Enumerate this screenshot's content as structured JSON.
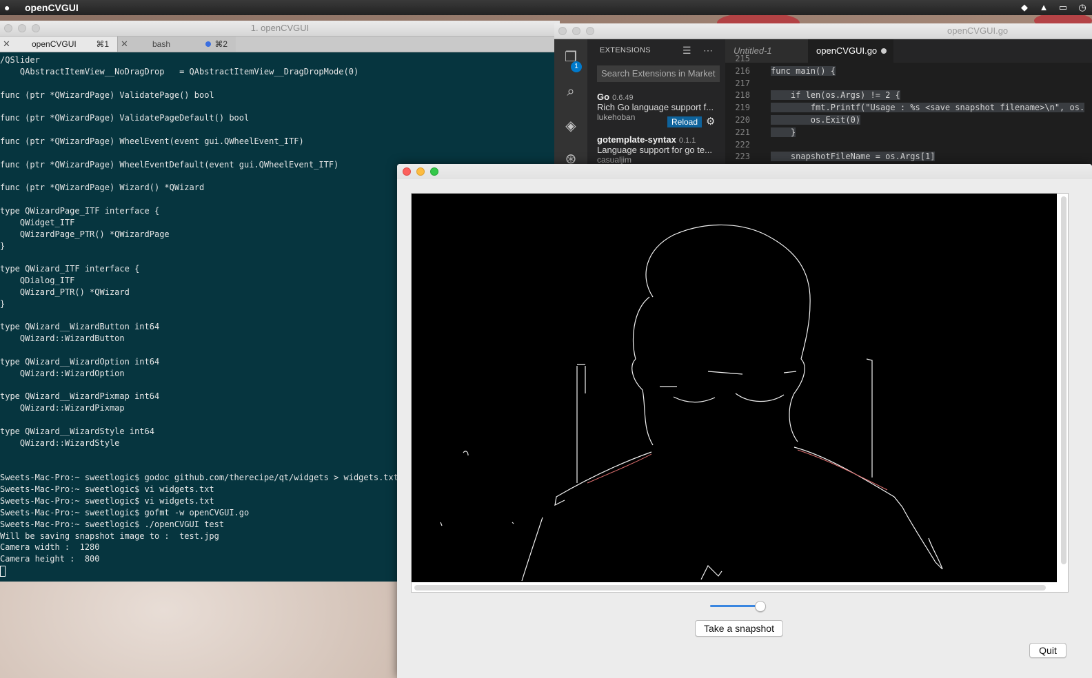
{
  "menubar": {
    "app_name": "openCVGUI"
  },
  "terminal": {
    "title": "1. openCVGUI",
    "tabs": [
      {
        "label": "openCVGUI",
        "shortcut": "⌘1"
      },
      {
        "label": "bash",
        "shortcut": "⌘2"
      }
    ],
    "lines": [
      "/QSlider",
      "    QAbstractItemView__NoDragDrop   = QAbstractItemView__DragDropMode(0)",
      "",
      "func (ptr *QWizardPage) ValidatePage() bool",
      "",
      "func (ptr *QWizardPage) ValidatePageDefault() bool",
      "",
      "func (ptr *QWizardPage) WheelEvent(event gui.QWheelEvent_ITF)",
      "",
      "func (ptr *QWizardPage) WheelEventDefault(event gui.QWheelEvent_ITF)",
      "",
      "func (ptr *QWizardPage) Wizard() *QWizard",
      "",
      "type QWizardPage_ITF interface {",
      "    QWidget_ITF",
      "    QWizardPage_PTR() *QWizardPage",
      "}",
      "",
      "type QWizard_ITF interface {",
      "    QDialog_ITF",
      "    QWizard_PTR() *QWizard",
      "}",
      "",
      "type QWizard__WizardButton int64",
      "    QWizard::WizardButton",
      "",
      "type QWizard__WizardOption int64",
      "    QWizard::WizardOption",
      "",
      "type QWizard__WizardPixmap int64",
      "    QWizard::WizardPixmap",
      "",
      "type QWizard__WizardStyle int64",
      "    QWizard::WizardStyle",
      "",
      "",
      "Sweets-Mac-Pro:~ sweetlogic$ godoc github.com/therecipe/qt/widgets > widgets.txt",
      "Sweets-Mac-Pro:~ sweetlogic$ vi widgets.txt",
      "Sweets-Mac-Pro:~ sweetlogic$ vi widgets.txt",
      "Sweets-Mac-Pro:~ sweetlogic$ gofmt -w openCVGUI.go",
      "Sweets-Mac-Pro:~ sweetlogic$ ./openCVGUI test",
      "Will be saving snapshot image to :  test.jpg",
      "Camera width :  1280",
      "Camera height :  800"
    ]
  },
  "vscode": {
    "title": "openCVGUI.go",
    "activity_badge": "1",
    "sidebar_header": "EXTENSIONS",
    "search_placeholder": "Search Extensions in Market",
    "extensions": [
      {
        "name": "Go",
        "version": "0.6.49",
        "description": "Rich Go language support f...",
        "author": "lukehoban",
        "action": "Reload"
      },
      {
        "name": "gotemplate-syntax",
        "version": "0.1.1",
        "description": "Language support for go te...",
        "author": "casualjim"
      }
    ],
    "tabs": [
      {
        "label": "Untitled-1"
      },
      {
        "label": "openCVGUI.go"
      }
    ],
    "code_lines": [
      {
        "n": "215",
        "text": ""
      },
      {
        "n": "216",
        "text": "func main() {"
      },
      {
        "n": "217",
        "text": ""
      },
      {
        "n": "218",
        "text": "    if len(os.Args) != 2 {"
      },
      {
        "n": "219",
        "text": "        fmt.Printf(\"Usage : %s <save snapshot filename>\\n\", os."
      },
      {
        "n": "220",
        "text": "        os.Exit(0)"
      },
      {
        "n": "221",
        "text": "    }"
      },
      {
        "n": "222",
        "text": ""
      },
      {
        "n": "223",
        "text": "    snapshotFileName = os.Args[1]"
      }
    ]
  },
  "cvwindow": {
    "slider_value": 0.86,
    "snapshot_button": "Take a snapshot",
    "quit_button": "Quit"
  },
  "colors": {
    "terminal_bg": "#06353f",
    "vscode_accent": "#007acc",
    "edge_stroke": "#f2f2f2"
  }
}
